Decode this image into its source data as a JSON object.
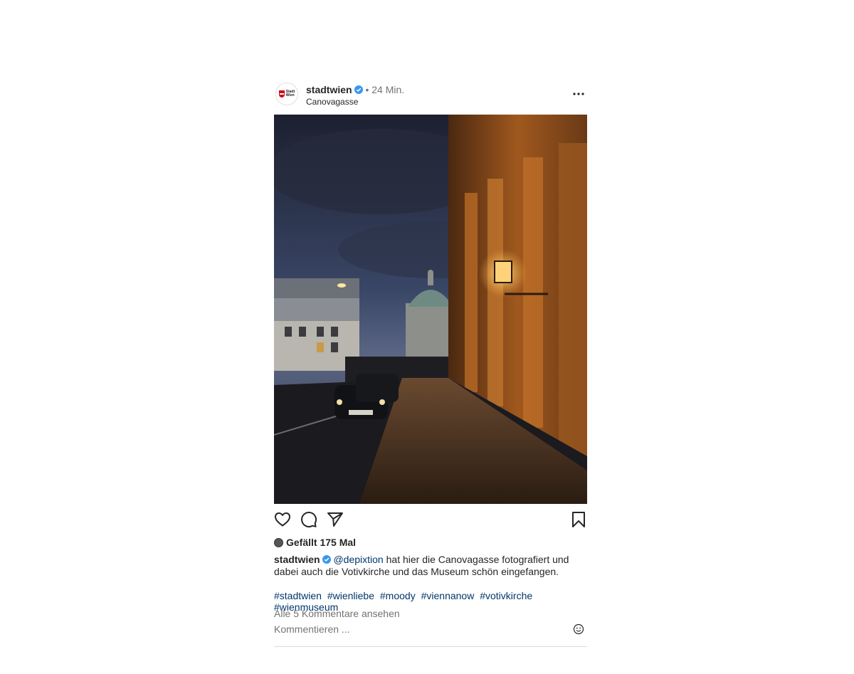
{
  "post": {
    "username": "stadtwien",
    "time_ago": "24 Min.",
    "location": "Canovagasse",
    "avatar_text": "Stadt Wien",
    "likes_text": "Gefällt 175 Mal",
    "caption": {
      "username": "stadtwien",
      "mention": "@depixtion",
      "text": " hat hier die Canovagasse fotografiert und dabei auch die Votivkirche und das Museum schön eingefangen."
    },
    "hashtags": [
      "#stadtwien",
      "#wienliebe",
      "#moody",
      "#viennanow",
      "#votivkirche",
      "#wienmuseum"
    ],
    "view_comments": "Alle 5 Kommentare ansehen",
    "comment_placeholder": "Kommentieren ..."
  },
  "icons": {
    "verified": "verified-badge-icon",
    "more": "more-options-icon",
    "like": "heart-icon",
    "comment": "comment-bubble-icon",
    "share": "paper-plane-icon",
    "save": "bookmark-icon",
    "emoji": "emoji-icon"
  },
  "colors": {
    "verified": "#3897f0",
    "link": "#00376b",
    "muted": "#737373",
    "brand_red": "#d4001a"
  }
}
